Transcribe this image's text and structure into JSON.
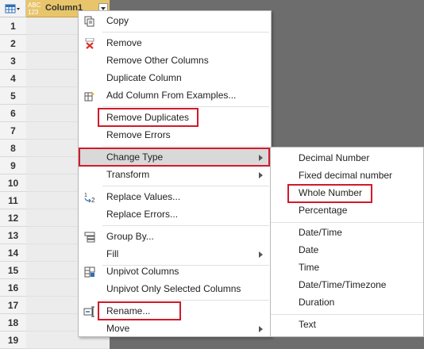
{
  "column_header": {
    "type_label_top": "ABC",
    "type_label_bottom": "123",
    "name": "Column1"
  },
  "row_numbers": [
    "1",
    "2",
    "3",
    "4",
    "5",
    "6",
    "7",
    "8",
    "9",
    "10",
    "11",
    "12",
    "13",
    "14",
    "15",
    "16",
    "17",
    "18",
    "19"
  ],
  "context_menu": {
    "items": [
      {
        "label": "Copy",
        "icon": "copy-icon"
      },
      {
        "label": "Remove",
        "icon": "remove-icon"
      },
      {
        "label": "Remove Other Columns"
      },
      {
        "label": "Duplicate Column"
      },
      {
        "label": "Add Column From Examples...",
        "icon": "add-column-examples-icon"
      },
      {
        "label": "Remove Duplicates",
        "highlighted_box": true
      },
      {
        "label": "Remove Errors"
      },
      {
        "label": "Change Type",
        "submenu": true,
        "hovered": true,
        "highlighted_box": true
      },
      {
        "label": "Transform",
        "submenu": true
      },
      {
        "label": "Replace Values...",
        "icon": "replace-values-icon"
      },
      {
        "label": "Replace Errors..."
      },
      {
        "label": "Group By...",
        "icon": "group-by-icon"
      },
      {
        "label": "Fill",
        "submenu": true
      },
      {
        "label": "Unpivot Columns",
        "icon": "unpivot-icon"
      },
      {
        "label": "Unpivot Only Selected Columns"
      },
      {
        "label": "Rename...",
        "icon": "rename-icon",
        "highlighted_box": true
      },
      {
        "label": "Move",
        "submenu": true
      }
    ]
  },
  "type_submenu": {
    "items": [
      {
        "label": "Decimal Number"
      },
      {
        "label": "Fixed decimal number"
      },
      {
        "label": "Whole Number",
        "highlighted_box": true
      },
      {
        "label": "Percentage"
      },
      {
        "label": "Date/Time"
      },
      {
        "label": "Date"
      },
      {
        "label": "Time"
      },
      {
        "label": "Date/Time/Timezone"
      },
      {
        "label": "Duration"
      },
      {
        "label": "Text"
      }
    ]
  },
  "colors": {
    "highlight_border": "#d11a2a",
    "column_header": "#e8c56a",
    "hover": "#d9d9d9"
  }
}
